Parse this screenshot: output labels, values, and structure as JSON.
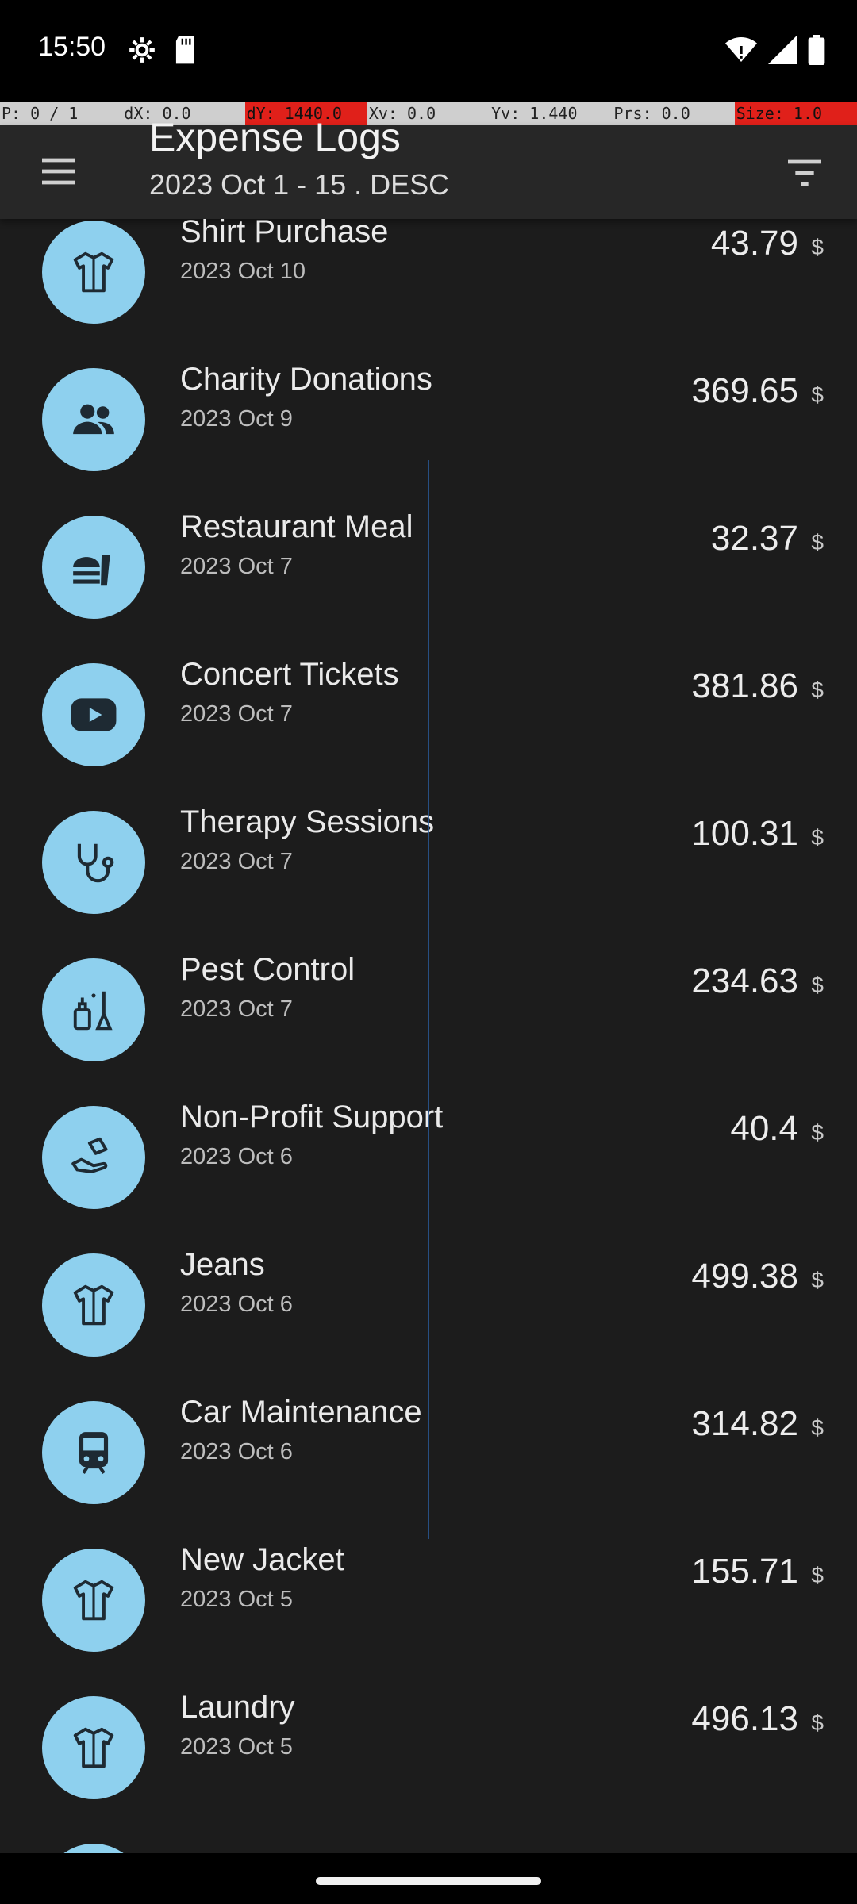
{
  "status_bar": {
    "time": "15:50"
  },
  "pointer_info": {
    "p": "P: 0 / 1",
    "dx": "dX: 0.0",
    "dy": "dY: 1440.0",
    "xv": "Xv: 0.0",
    "yv": "Yv: 1.440",
    "prs": "Prs: 0.0",
    "size": "Size: 1.0"
  },
  "app_bar": {
    "title": "Expense Logs",
    "subtitle": "2023 Oct 1 - 15 . DESC",
    "menu_icon": "menu-icon",
    "filter_icon": "filter-icon"
  },
  "colors": {
    "avatar_bg": "#8ed0ee",
    "background": "#1c1c1c",
    "app_bar": "#272727"
  },
  "expenses": [
    {
      "title": "Shirt Purchase",
      "date": "2023 Oct 10",
      "amount": "43.79",
      "currency": "$",
      "icon": "shirt-icon"
    },
    {
      "title": "Charity Donations",
      "date": "2023 Oct 9",
      "amount": "369.65",
      "currency": "$",
      "icon": "people-icon"
    },
    {
      "title": "Restaurant Meal",
      "date": "2023 Oct 7",
      "amount": "32.37",
      "currency": "$",
      "icon": "fastfood-icon"
    },
    {
      "title": "Concert Tickets",
      "date": "2023 Oct 7",
      "amount": "381.86",
      "currency": "$",
      "icon": "play-icon"
    },
    {
      "title": "Therapy Sessions",
      "date": "2023 Oct 7",
      "amount": "100.31",
      "currency": "$",
      "icon": "stethoscope-icon"
    },
    {
      "title": "Pest Control",
      "date": "2023 Oct 7",
      "amount": "234.63",
      "currency": "$",
      "icon": "cleaning-icon"
    },
    {
      "title": "Non-Profit Support",
      "date": "2023 Oct 6",
      "amount": "40.4",
      "currency": "$",
      "icon": "donation-hand-icon"
    },
    {
      "title": "Jeans",
      "date": "2023 Oct 6",
      "amount": "499.38",
      "currency": "$",
      "icon": "shirt-icon"
    },
    {
      "title": "Car Maintenance",
      "date": "2023 Oct 6",
      "amount": "314.82",
      "currency": "$",
      "icon": "train-icon"
    },
    {
      "title": "New Jacket",
      "date": "2023 Oct 5",
      "amount": "155.71",
      "currency": "$",
      "icon": "shirt-icon"
    },
    {
      "title": "Laundry",
      "date": "2023 Oct 5",
      "amount": "496.13",
      "currency": "$",
      "icon": "shirt-icon"
    }
  ]
}
